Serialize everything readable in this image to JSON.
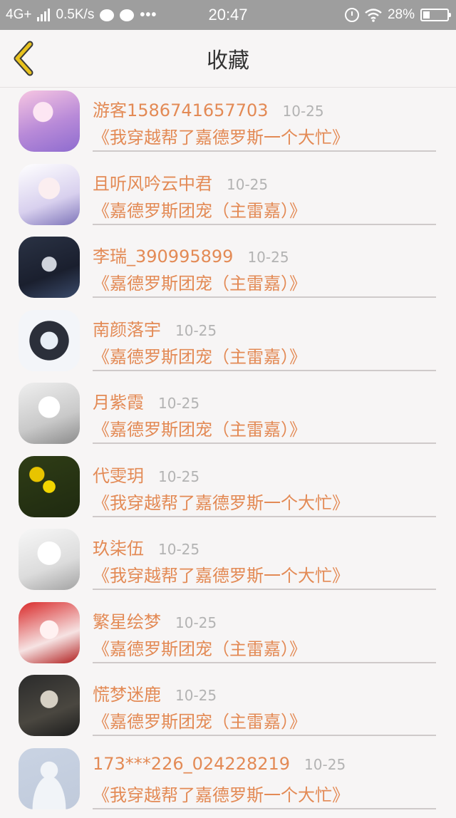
{
  "status_bar": {
    "network": "4G+",
    "speed": "0.5K/s",
    "dots": "•••",
    "time": "20:47",
    "battery": "28%",
    "battery_level": 0.28
  },
  "nav": {
    "title": "收藏",
    "back_icon": "chevron-left-icon",
    "accent": "#e8c21e"
  },
  "favorites": [
    {
      "name": "游客1586741657703",
      "date": "10-25",
      "book": "《我穿越帮了嘉德罗斯一个大忙》"
    },
    {
      "name": "且听风吟云中君",
      "date": "10-25",
      "book": "《嘉德罗斯团宠（主雷嘉）》"
    },
    {
      "name": "李瑞_390995899",
      "date": "10-25",
      "book": "《嘉德罗斯团宠（主雷嘉）》"
    },
    {
      "name": "南颜落宇",
      "date": "10-25",
      "book": "《嘉德罗斯团宠（主雷嘉）》"
    },
    {
      "name": "月紫霞",
      "date": "10-25",
      "book": "《嘉德罗斯团宠（主雷嘉）》"
    },
    {
      "name": "代雯玥",
      "date": "10-25",
      "book": "《我穿越帮了嘉德罗斯一个大忙》"
    },
    {
      "name": "玖柒伍",
      "date": "10-25",
      "book": "《我穿越帮了嘉德罗斯一个大忙》"
    },
    {
      "name": "繁星绘梦",
      "date": "10-25",
      "book": "《嘉德罗斯团宠（主雷嘉）》"
    },
    {
      "name": "慌梦迷鹿",
      "date": "10-25",
      "book": "《嘉德罗斯团宠（主雷嘉）》"
    },
    {
      "name": "173***226_024228219",
      "date": "10-25",
      "book": "《我穿越帮了嘉德罗斯一个大忙》"
    }
  ]
}
